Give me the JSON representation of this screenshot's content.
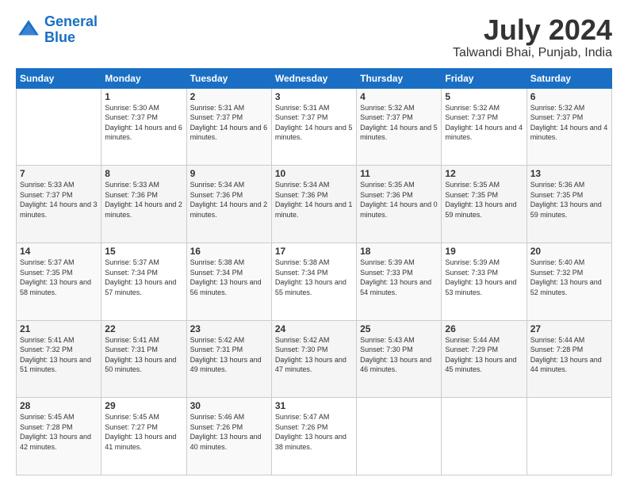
{
  "header": {
    "logo_line1": "General",
    "logo_line2": "Blue",
    "month": "July 2024",
    "location": "Talwandi Bhai, Punjab, India"
  },
  "days_of_week": [
    "Sunday",
    "Monday",
    "Tuesday",
    "Wednesday",
    "Thursday",
    "Friday",
    "Saturday"
  ],
  "weeks": [
    [
      {
        "day": "",
        "sunrise": "",
        "sunset": "",
        "daylight": ""
      },
      {
        "day": "1",
        "sunrise": "Sunrise: 5:30 AM",
        "sunset": "Sunset: 7:37 PM",
        "daylight": "Daylight: 14 hours and 6 minutes."
      },
      {
        "day": "2",
        "sunrise": "Sunrise: 5:31 AM",
        "sunset": "Sunset: 7:37 PM",
        "daylight": "Daylight: 14 hours and 6 minutes."
      },
      {
        "day": "3",
        "sunrise": "Sunrise: 5:31 AM",
        "sunset": "Sunset: 7:37 PM",
        "daylight": "Daylight: 14 hours and 5 minutes."
      },
      {
        "day": "4",
        "sunrise": "Sunrise: 5:32 AM",
        "sunset": "Sunset: 7:37 PM",
        "daylight": "Daylight: 14 hours and 5 minutes."
      },
      {
        "day": "5",
        "sunrise": "Sunrise: 5:32 AM",
        "sunset": "Sunset: 7:37 PM",
        "daylight": "Daylight: 14 hours and 4 minutes."
      },
      {
        "day": "6",
        "sunrise": "Sunrise: 5:32 AM",
        "sunset": "Sunset: 7:37 PM",
        "daylight": "Daylight: 14 hours and 4 minutes."
      }
    ],
    [
      {
        "day": "7",
        "sunrise": "Sunrise: 5:33 AM",
        "sunset": "Sunset: 7:37 PM",
        "daylight": "Daylight: 14 hours and 3 minutes."
      },
      {
        "day": "8",
        "sunrise": "Sunrise: 5:33 AM",
        "sunset": "Sunset: 7:36 PM",
        "daylight": "Daylight: 14 hours and 2 minutes."
      },
      {
        "day": "9",
        "sunrise": "Sunrise: 5:34 AM",
        "sunset": "Sunset: 7:36 PM",
        "daylight": "Daylight: 14 hours and 2 minutes."
      },
      {
        "day": "10",
        "sunrise": "Sunrise: 5:34 AM",
        "sunset": "Sunset: 7:36 PM",
        "daylight": "Daylight: 14 hours and 1 minute."
      },
      {
        "day": "11",
        "sunrise": "Sunrise: 5:35 AM",
        "sunset": "Sunset: 7:36 PM",
        "daylight": "Daylight: 14 hours and 0 minutes."
      },
      {
        "day": "12",
        "sunrise": "Sunrise: 5:35 AM",
        "sunset": "Sunset: 7:35 PM",
        "daylight": "Daylight: 13 hours and 59 minutes."
      },
      {
        "day": "13",
        "sunrise": "Sunrise: 5:36 AM",
        "sunset": "Sunset: 7:35 PM",
        "daylight": "Daylight: 13 hours and 59 minutes."
      }
    ],
    [
      {
        "day": "14",
        "sunrise": "Sunrise: 5:37 AM",
        "sunset": "Sunset: 7:35 PM",
        "daylight": "Daylight: 13 hours and 58 minutes."
      },
      {
        "day": "15",
        "sunrise": "Sunrise: 5:37 AM",
        "sunset": "Sunset: 7:34 PM",
        "daylight": "Daylight: 13 hours and 57 minutes."
      },
      {
        "day": "16",
        "sunrise": "Sunrise: 5:38 AM",
        "sunset": "Sunset: 7:34 PM",
        "daylight": "Daylight: 13 hours and 56 minutes."
      },
      {
        "day": "17",
        "sunrise": "Sunrise: 5:38 AM",
        "sunset": "Sunset: 7:34 PM",
        "daylight": "Daylight: 13 hours and 55 minutes."
      },
      {
        "day": "18",
        "sunrise": "Sunrise: 5:39 AM",
        "sunset": "Sunset: 7:33 PM",
        "daylight": "Daylight: 13 hours and 54 minutes."
      },
      {
        "day": "19",
        "sunrise": "Sunrise: 5:39 AM",
        "sunset": "Sunset: 7:33 PM",
        "daylight": "Daylight: 13 hours and 53 minutes."
      },
      {
        "day": "20",
        "sunrise": "Sunrise: 5:40 AM",
        "sunset": "Sunset: 7:32 PM",
        "daylight": "Daylight: 13 hours and 52 minutes."
      }
    ],
    [
      {
        "day": "21",
        "sunrise": "Sunrise: 5:41 AM",
        "sunset": "Sunset: 7:32 PM",
        "daylight": "Daylight: 13 hours and 51 minutes."
      },
      {
        "day": "22",
        "sunrise": "Sunrise: 5:41 AM",
        "sunset": "Sunset: 7:31 PM",
        "daylight": "Daylight: 13 hours and 50 minutes."
      },
      {
        "day": "23",
        "sunrise": "Sunrise: 5:42 AM",
        "sunset": "Sunset: 7:31 PM",
        "daylight": "Daylight: 13 hours and 49 minutes."
      },
      {
        "day": "24",
        "sunrise": "Sunrise: 5:42 AM",
        "sunset": "Sunset: 7:30 PM",
        "daylight": "Daylight: 13 hours and 47 minutes."
      },
      {
        "day": "25",
        "sunrise": "Sunrise: 5:43 AM",
        "sunset": "Sunset: 7:30 PM",
        "daylight": "Daylight: 13 hours and 46 minutes."
      },
      {
        "day": "26",
        "sunrise": "Sunrise: 5:44 AM",
        "sunset": "Sunset: 7:29 PM",
        "daylight": "Daylight: 13 hours and 45 minutes."
      },
      {
        "day": "27",
        "sunrise": "Sunrise: 5:44 AM",
        "sunset": "Sunset: 7:28 PM",
        "daylight": "Daylight: 13 hours and 44 minutes."
      }
    ],
    [
      {
        "day": "28",
        "sunrise": "Sunrise: 5:45 AM",
        "sunset": "Sunset: 7:28 PM",
        "daylight": "Daylight: 13 hours and 42 minutes."
      },
      {
        "day": "29",
        "sunrise": "Sunrise: 5:45 AM",
        "sunset": "Sunset: 7:27 PM",
        "daylight": "Daylight: 13 hours and 41 minutes."
      },
      {
        "day": "30",
        "sunrise": "Sunrise: 5:46 AM",
        "sunset": "Sunset: 7:26 PM",
        "daylight": "Daylight: 13 hours and 40 minutes."
      },
      {
        "day": "31",
        "sunrise": "Sunrise: 5:47 AM",
        "sunset": "Sunset: 7:26 PM",
        "daylight": "Daylight: 13 hours and 38 minutes."
      },
      {
        "day": "",
        "sunrise": "",
        "sunset": "",
        "daylight": ""
      },
      {
        "day": "",
        "sunrise": "",
        "sunset": "",
        "daylight": ""
      },
      {
        "day": "",
        "sunrise": "",
        "sunset": "",
        "daylight": ""
      }
    ]
  ]
}
